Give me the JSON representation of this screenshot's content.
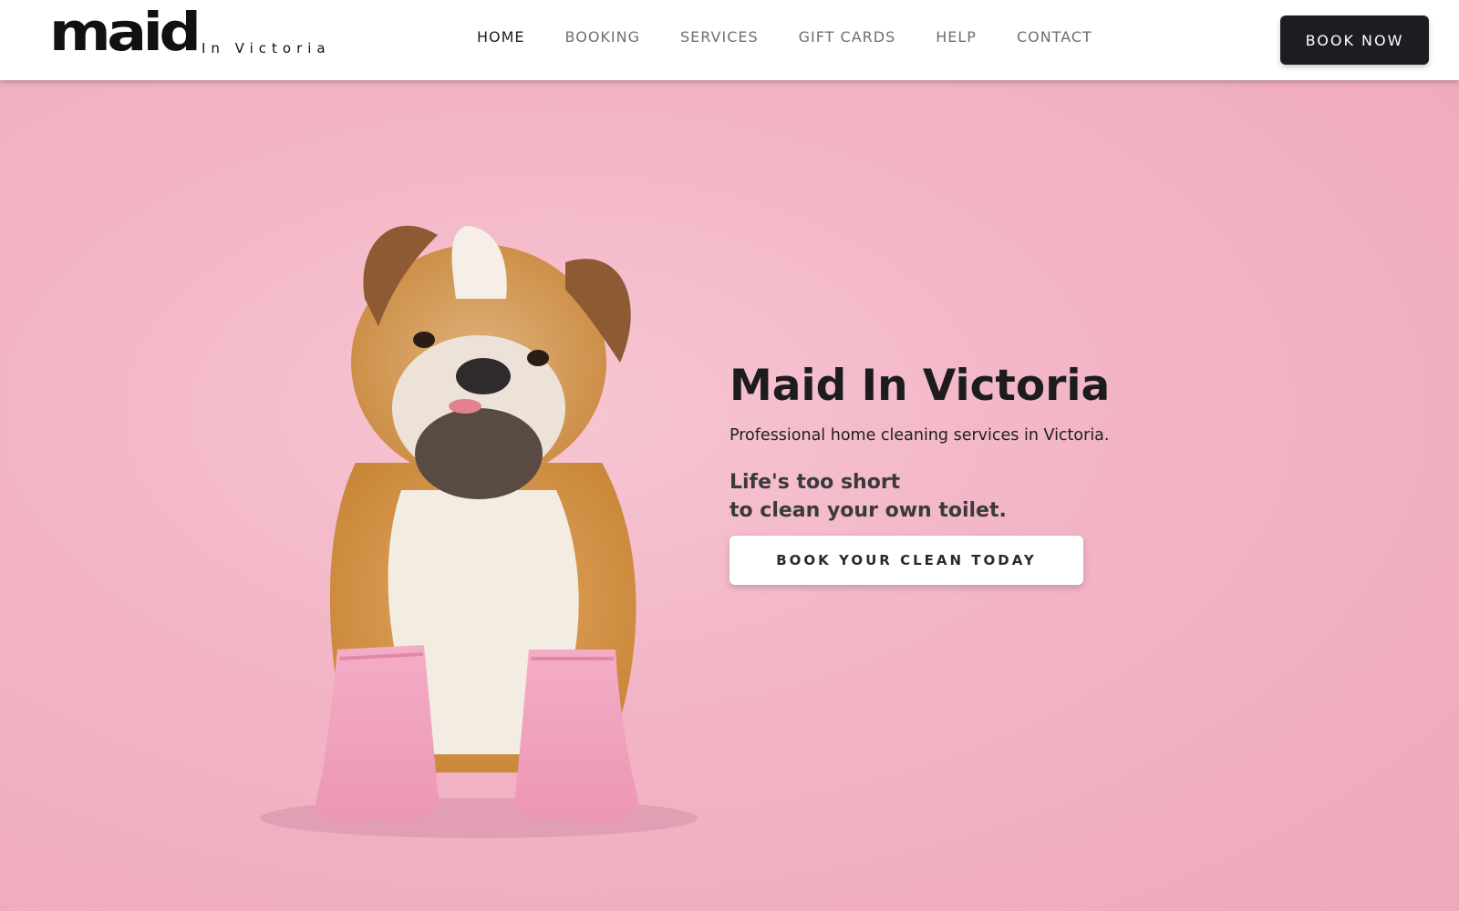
{
  "logo": {
    "main": "maid",
    "sub": "In Victoria"
  },
  "nav": {
    "items": [
      {
        "label": "HOME",
        "active": true
      },
      {
        "label": "BOOKING",
        "active": false
      },
      {
        "label": "SERVICES",
        "active": false
      },
      {
        "label": "GIFT CARDS",
        "active": false
      },
      {
        "label": "HELP",
        "active": false
      },
      {
        "label": "CONTACT",
        "active": false
      }
    ]
  },
  "header": {
    "book_now_label": "BOOK NOW"
  },
  "hero": {
    "title": "Maid In Victoria",
    "subtitle": "Professional home cleaning services in Victoria.",
    "tagline_line1": "Life's too short",
    "tagline_line2": "to clean your own toilet.",
    "cta_label": "BOOK YOUR CLEAN TODAY",
    "image": "bulldog-wearing-pink-rubber-gloves"
  },
  "colors": {
    "background_pink": "#f0b4c4",
    "header_bg": "#ffffff",
    "button_dark": "#1b1d20",
    "text_dark": "#1c1c1e",
    "glove_pink": "#f0a3bd",
    "dog_tan": "#d99a4e"
  }
}
